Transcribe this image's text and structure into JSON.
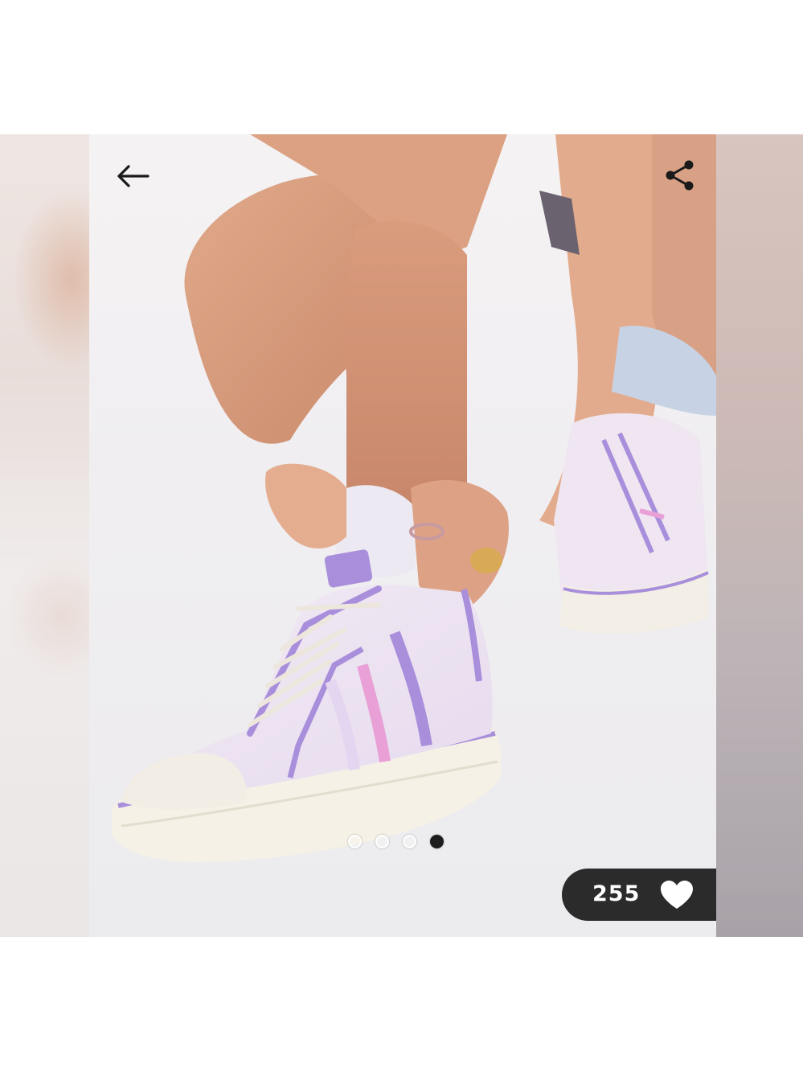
{
  "viewer": {
    "back_icon": "arrow-left-icon",
    "share_icon": "share-icon",
    "dots": [
      {
        "active": false
      },
      {
        "active": false
      },
      {
        "active": false
      },
      {
        "active": true
      }
    ],
    "likes": {
      "count": "255",
      "icon": "heart-icon"
    }
  },
  "colors": {
    "like_pill": "#2b2b2b",
    "active_dot": "#1d1d1d",
    "shoe_lilac": "#a98fdb",
    "shoe_pink": "#e8a0d6"
  }
}
